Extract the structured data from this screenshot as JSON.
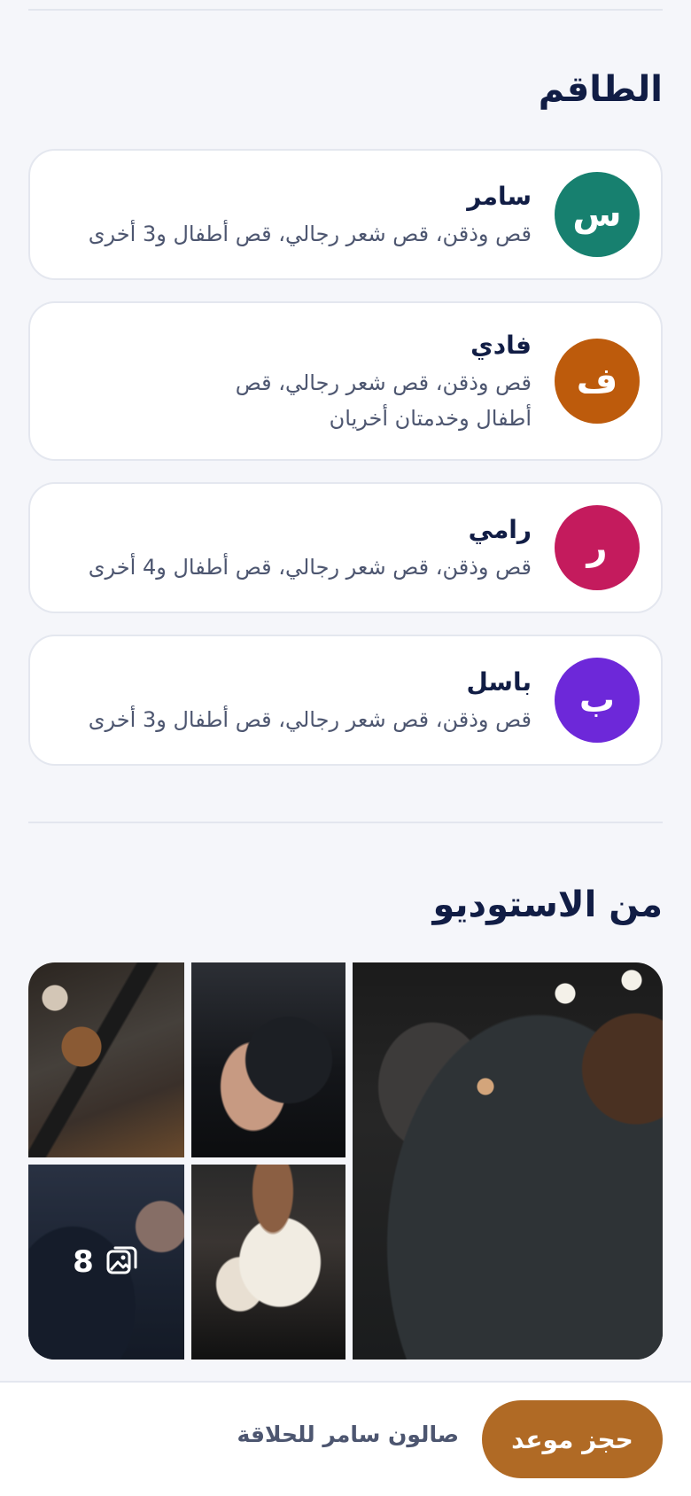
{
  "team": {
    "title": "الطاقم",
    "members": [
      {
        "initial": "س",
        "name": "سامر",
        "services": "قص وذقن، قص شعر رجالي، قص أطفال و3 أخرى",
        "color": "#17806f"
      },
      {
        "initial": "ف",
        "name": "فادي",
        "services": "قص وذقن، قص شعر رجالي، قص أطفال وخدمتان أخريان",
        "color": "#bd5b0c"
      },
      {
        "initial": "ر",
        "name": "رامي",
        "services": "قص وذقن، قص شعر رجالي، قص أطفال و4 أخرى",
        "color": "#c41b5d"
      },
      {
        "initial": "ب",
        "name": "باسل",
        "services": "قص وذقن، قص شعر رجالي، قص أطفال و3 أخرى",
        "color": "#6d28d9"
      }
    ]
  },
  "studio": {
    "title": "من الاستوديو",
    "more_count": "8",
    "more_icon": "gallery-icon"
  },
  "footer": {
    "salon_name": "صالون سامر للحلاقة",
    "book_label": "حجز موعد",
    "accent": "#b06a25"
  }
}
